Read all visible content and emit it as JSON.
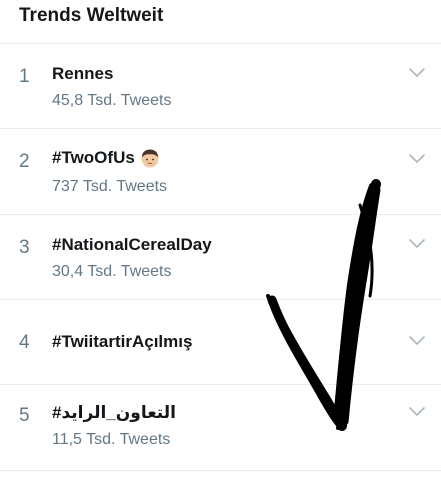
{
  "header": {
    "title": "Trends Weltweit"
  },
  "trends": [
    {
      "rank": "1",
      "name": "Rennes",
      "count": "45,8 Tsd. Tweets",
      "has_emoji": false
    },
    {
      "rank": "2",
      "name": "#TwoOfUs",
      "count": "737 Tsd. Tweets",
      "has_emoji": true,
      "emoji_icon": "boy-face-emoji-icon"
    },
    {
      "rank": "3",
      "name": "#NationalCerealDay",
      "count": "30,4 Tsd. Tweets",
      "has_emoji": false
    },
    {
      "rank": "4",
      "name": "#TwiitartirAçılmış",
      "count": "",
      "has_emoji": false
    },
    {
      "rank": "5",
      "name": "#التعاون_الرايد",
      "count": "11,5 Tsd. Tweets",
      "has_emoji": false
    }
  ],
  "colors": {
    "text_primary": "#14171a",
    "text_secondary": "#657786",
    "divider": "#e6ecf0",
    "chevron": "#aab8c2",
    "checkmark_ink": "#000000"
  },
  "annotation": {
    "icon": "hand-drawn-checkmark-icon"
  }
}
